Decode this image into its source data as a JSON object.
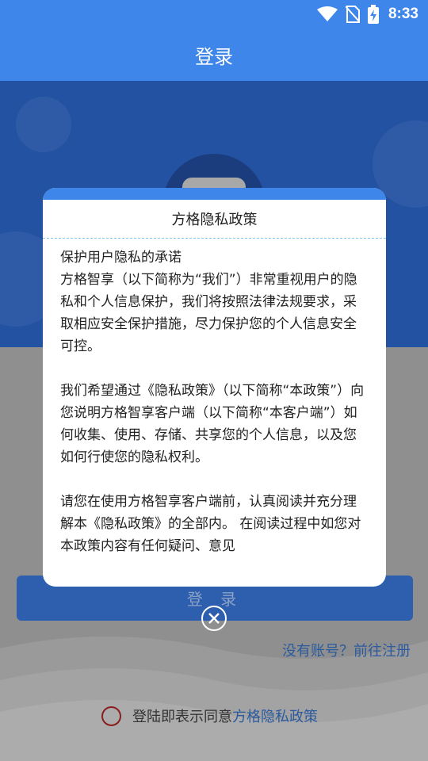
{
  "status_bar": {
    "time": "8:33",
    "icons": [
      "wifi-icon",
      "no-sim-icon",
      "battery-charging-icon"
    ]
  },
  "header": {
    "title": "登录"
  },
  "login": {
    "button_label": "登 录",
    "register_link": "没有账号？前往注册",
    "agree_text": "登陆即表示同意",
    "agree_link": "方格隐私政策"
  },
  "modal": {
    "title": "方格隐私政策",
    "heading": "保护用户隐私的承诺",
    "paragraphs": [
      "方格智享（以下简称为“我们”）非常重视用户的隐私和个人信息保护，我们将按照法律法规要求，采取相应安全保护措施，尽力保护您的个人信息安全可控。",
      "我们希望通过《隐私政策》（以下简称“本政策”）向您说明方格智享客户端（以下简称“本客户端”）如何收集、使用、存储、共享您的个人信息，以及您如何行使您的隐私权利。",
      "请您在使用方格智享客户端前，认真阅读并充分理解本《隐私政策》的全部内。 在阅读过程中如您对本政策内容有任何疑问、意见"
    ],
    "close_icon": "close-icon"
  },
  "colors": {
    "accent": "#3f86ea",
    "hero_dim": "#2452a2",
    "link": "#2b5a9e"
  }
}
